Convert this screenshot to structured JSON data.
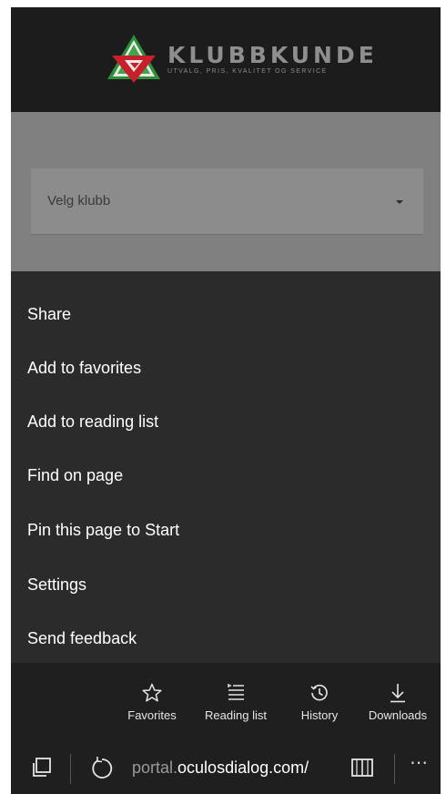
{
  "brand": {
    "name": "KLUBBKUNDE",
    "tagline": "UTVALG, PRIS, KVALITET OG SERVICE"
  },
  "club_select": {
    "value": "Velg klubb"
  },
  "menu": {
    "items": [
      {
        "label": "Share"
      },
      {
        "label": "Add to favorites"
      },
      {
        "label": "Add to reading list"
      },
      {
        "label": "Find on page"
      },
      {
        "label": "Pin this page to Start"
      },
      {
        "label": "Settings"
      },
      {
        "label": "Send feedback"
      }
    ]
  },
  "toolbar": {
    "quick": [
      {
        "label": "Favorites",
        "icon": "star-icon"
      },
      {
        "label": "Reading list",
        "icon": "reading-list-icon"
      },
      {
        "label": "History",
        "icon": "history-icon"
      },
      {
        "label": "Downloads",
        "icon": "download-icon"
      }
    ]
  },
  "address_bar": {
    "url_prefix": "portal.",
    "url_domain": "oculosdialog.com/"
  },
  "colors": {
    "menu_bg": "#2b2b2b",
    "toolbar_bg": "#1f1f1f",
    "header_bg": "#1c1c1c",
    "logo_red": "#c8202a",
    "logo_green": "#2f8f3a"
  }
}
